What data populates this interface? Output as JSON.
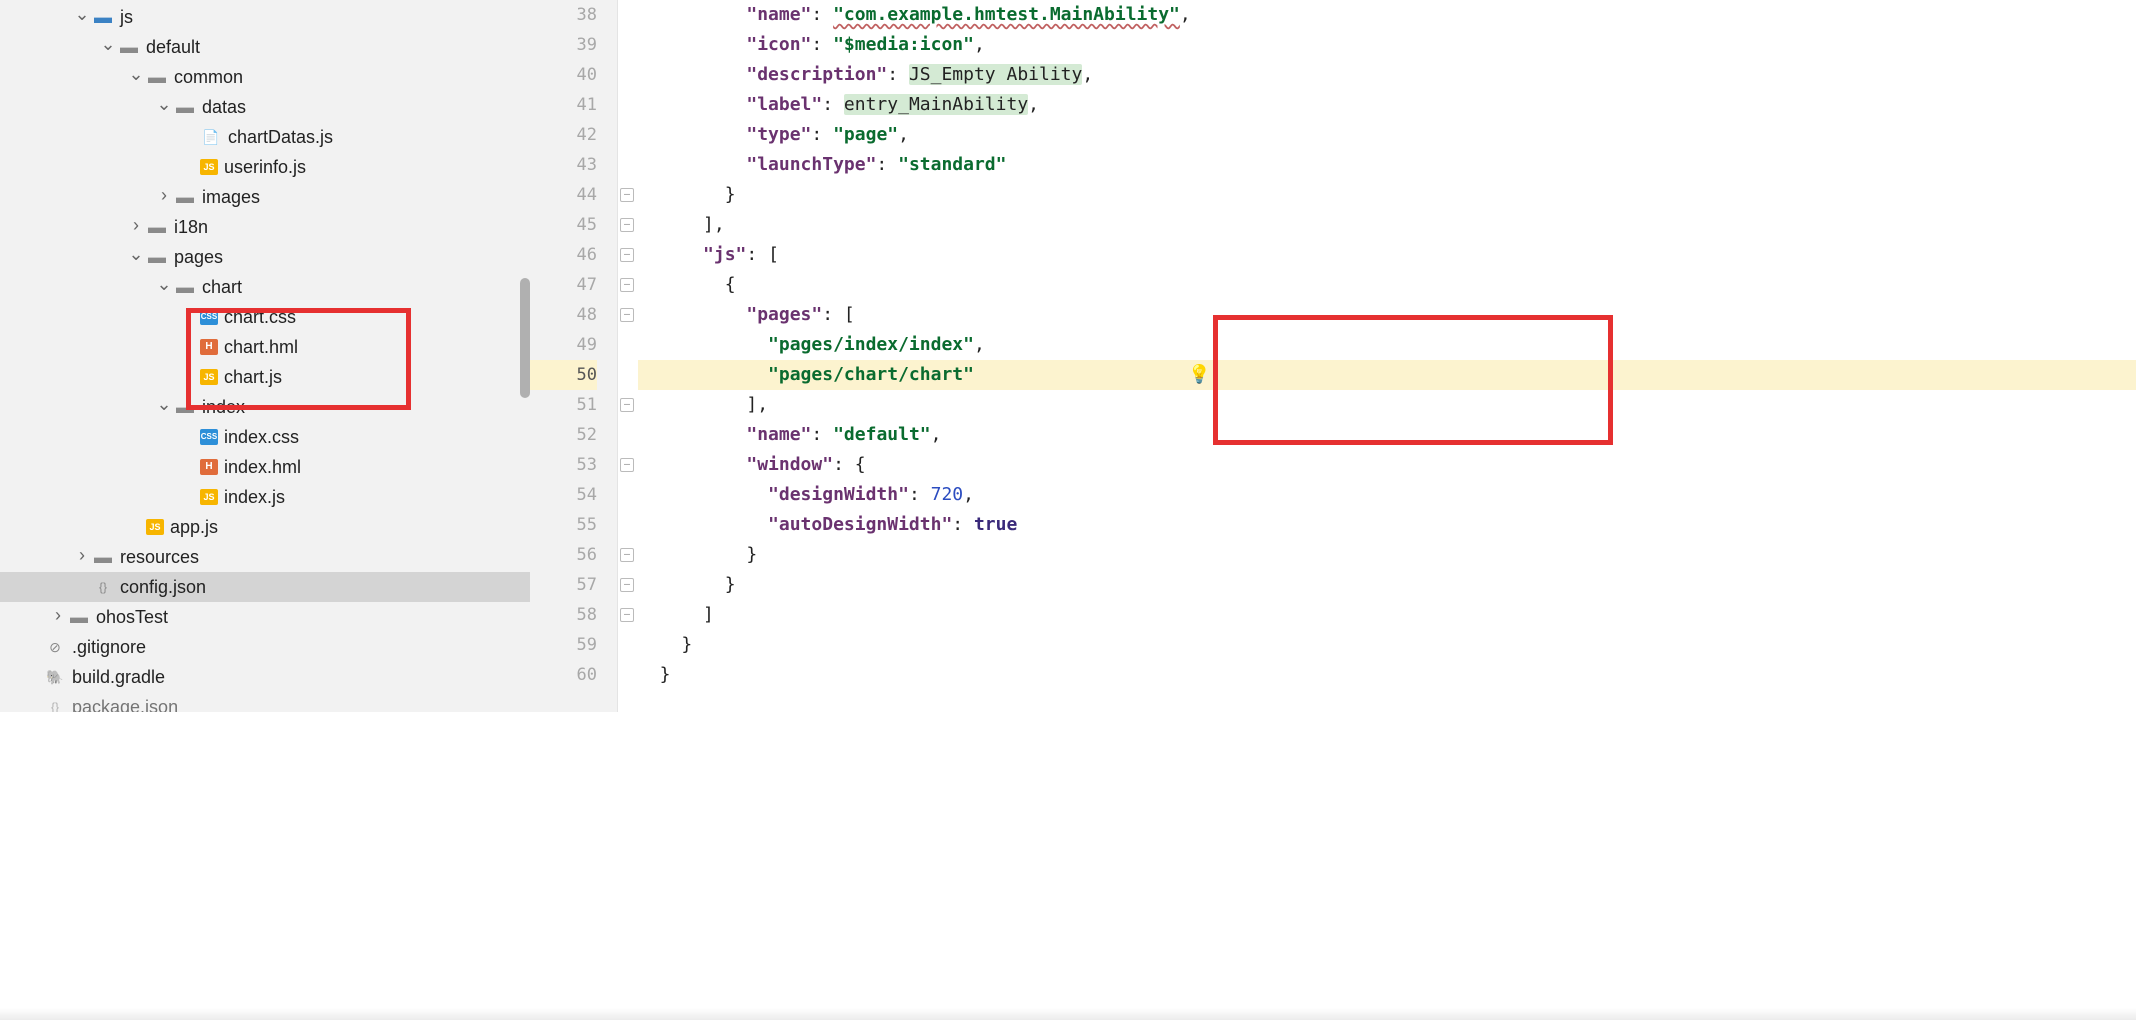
{
  "tree": {
    "js": "js",
    "default": "default",
    "common": "common",
    "datas": "datas",
    "chartDatas": "chartDatas.js",
    "userinfo": "userinfo.js",
    "images": "images",
    "i18n": "i18n",
    "pages": "pages",
    "chart": "chart",
    "chart_css": "chart.css",
    "chart_hml": "chart.hml",
    "chart_js": "chart.js",
    "index": "index",
    "index_css": "index.css",
    "index_hml": "index.hml",
    "index_js": "index.js",
    "app_js": "app.js",
    "resources": "resources",
    "config_json": "config.json",
    "ohosTest": "ohosTest",
    "gitignore": ".gitignore",
    "build_gradle": "build.gradle",
    "package_json": "package.json"
  },
  "gutter": {
    "start": 38,
    "end": 60,
    "highlight": 50
  },
  "code": {
    "l38_key": "\"name\"",
    "l38_val": "\"com.example.hmtest.MainAbility\"",
    "l39_key": "\"icon\"",
    "l39_val": "\"$media:icon\"",
    "l40_key": "\"description\"",
    "l40_val": "JS_Empty Ability",
    "l41_key": "\"label\"",
    "l41_val": "entry_MainAbility",
    "l42_key": "\"type\"",
    "l42_val": "\"page\"",
    "l43_key": "\"launchType\"",
    "l43_val": "\"standard\"",
    "l44": "        }",
    "l45": "      ],",
    "l46_key": "\"js\"",
    "l47": "        {",
    "l48_key": "\"pages\"",
    "l49_val": "\"pages/index/index\"",
    "l50_val": "\"pages/chart/chart\"",
    "l51": "          ],",
    "l52_key": "\"name\"",
    "l52_val": "\"default\"",
    "l53_key": "\"window\"",
    "l54_key": "\"designWidth\"",
    "l54_val": "720",
    "l55_key": "\"autoDesignWidth\"",
    "l55_val": "true",
    "l56": "          }",
    "l57": "        }",
    "l58": "      ]",
    "l59": "    }",
    "l60": "  }"
  }
}
